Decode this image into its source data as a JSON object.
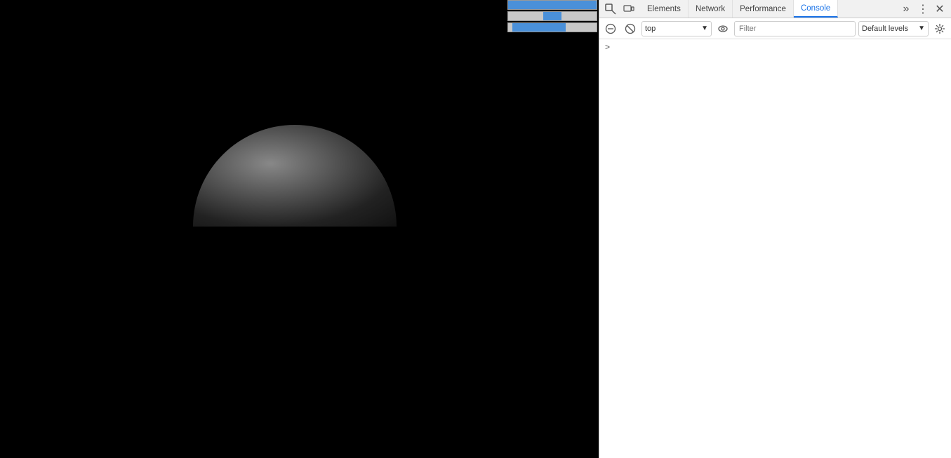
{
  "canvas": {
    "background": "#000000"
  },
  "devtools": {
    "tabs": [
      {
        "id": "elements",
        "label": "Elements",
        "active": false
      },
      {
        "id": "network",
        "label": "Network",
        "active": false
      },
      {
        "id": "performance",
        "label": "Performance",
        "active": false
      },
      {
        "id": "console",
        "label": "Console",
        "active": true
      }
    ],
    "icons": {
      "inspect": "⬚",
      "device": "▭",
      "more": "»",
      "dots": "⋮",
      "close": "✕"
    },
    "toolbar": {
      "clear_label": "🚫",
      "block_label": "⊘",
      "context_label": "top",
      "eye_label": "👁",
      "filter_placeholder": "Filter",
      "levels_label": "Default levels",
      "settings_label": "⚙"
    },
    "console": {
      "prompt_arrow": ">"
    }
  },
  "scrollbars": [
    {
      "left": "0%",
      "width": "100%"
    },
    {
      "left": "40%",
      "width": "20%"
    },
    {
      "left": "5%",
      "width": "60%"
    }
  ]
}
